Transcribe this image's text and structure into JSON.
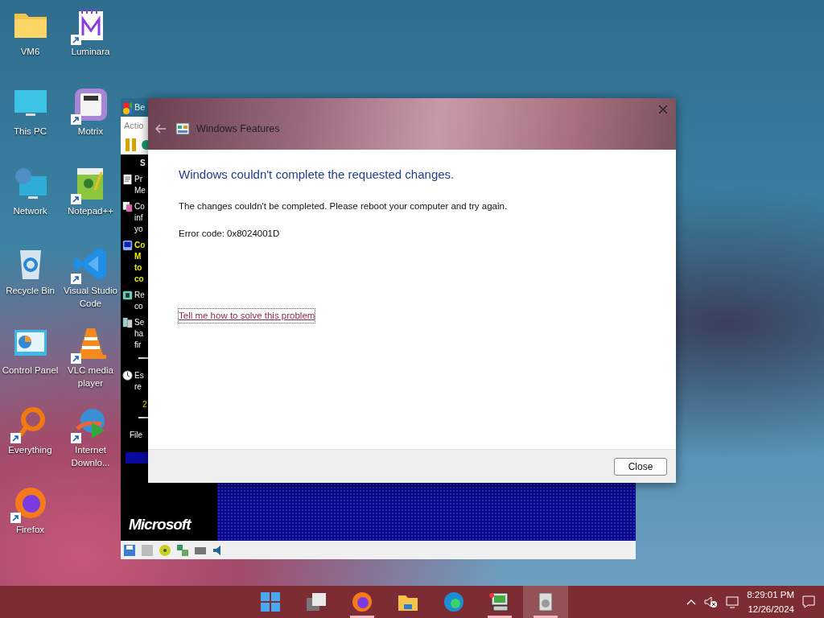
{
  "desktop_icons": [
    {
      "label": "VM6",
      "kind": "folder",
      "shortcut": false
    },
    {
      "label": "This PC",
      "kind": "monitor",
      "shortcut": false
    },
    {
      "label": "Network",
      "kind": "network",
      "shortcut": false
    },
    {
      "label": "Recycle Bin",
      "kind": "recycle",
      "shortcut": false
    },
    {
      "label": "Control Panel",
      "kind": "panel",
      "shortcut": false
    },
    {
      "label": "Everything",
      "kind": "magnifier",
      "shortcut": true
    },
    {
      "label": "Firefox",
      "kind": "firefox",
      "shortcut": true
    },
    {
      "label": "Luminara",
      "kind": "notebook",
      "shortcut": true
    },
    {
      "label": "Motrix",
      "kind": "box",
      "shortcut": true
    },
    {
      "label": "Notepad++",
      "kind": "notepad",
      "shortcut": true
    },
    {
      "label": "Visual Studio Code",
      "kind": "vscode",
      "shortcut": true
    },
    {
      "label": "VLC media player",
      "kind": "cone",
      "shortcut": true
    },
    {
      "label": "Internet Downlo...",
      "kind": "globe",
      "shortcut": true
    }
  ],
  "vm_window": {
    "title": "Be",
    "menu": "Actio",
    "heading": "S",
    "items": [
      {
        "lines": [
          "Pr",
          "Me"
        ],
        "highlight": false,
        "kind": "doc"
      },
      {
        "lines": [
          "Co",
          "inf",
          "yo"
        ],
        "highlight": false,
        "kind": "sheets"
      },
      {
        "lines": [
          "Co",
          "M",
          "to",
          "co"
        ],
        "highlight": true,
        "kind": "disk"
      },
      {
        "lines": [
          "Re",
          "co"
        ],
        "highlight": false,
        "kind": "chip"
      },
      {
        "lines": [
          "Se",
          "ha",
          "fir"
        ],
        "highlight": false,
        "kind": "server"
      },
      {
        "lines": [
          "Es",
          "re"
        ],
        "highlight": false,
        "kind": "clock"
      }
    ],
    "note": "2",
    "footer": "File",
    "logo": "Microsoft"
  },
  "dialog": {
    "title": "Windows Features",
    "back_enabled": false,
    "heading": "Windows couldn't complete the requested changes.",
    "message": "The changes couldn't be completed. Please reboot your computer and try again.",
    "error": "Error code: 0x8024001D",
    "link": "Tell me how to solve this problem",
    "button": "Close"
  },
  "taskbar": {
    "apps": [
      {
        "kind": "start",
        "selected": false,
        "running": false
      },
      {
        "kind": "taskview",
        "selected": false,
        "running": false
      },
      {
        "kind": "firefox",
        "selected": false,
        "running": true
      },
      {
        "kind": "explorer",
        "selected": false,
        "running": false
      },
      {
        "kind": "edge",
        "selected": false,
        "running": false
      },
      {
        "kind": "vm",
        "selected": false,
        "running": true
      },
      {
        "kind": "features",
        "selected": true,
        "running": true
      }
    ],
    "time": "8:29:01 PM",
    "date": "12/26/2024"
  }
}
